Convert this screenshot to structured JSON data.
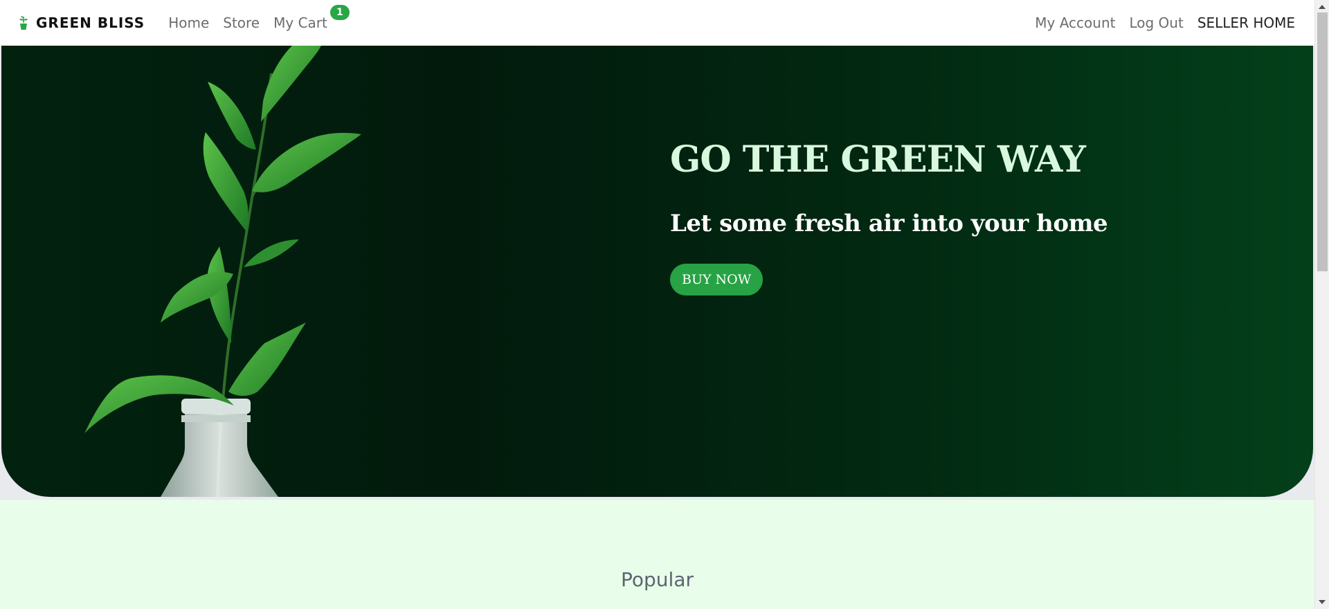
{
  "navbar": {
    "brand": "GREEN BLISS",
    "brand_icon": "plant-pot-icon",
    "links_left": [
      {
        "label": "Home"
      },
      {
        "label": "Store"
      },
      {
        "label": "My Cart",
        "badge": "1"
      }
    ],
    "links_right": [
      {
        "label": "My Account"
      },
      {
        "label": "Log Out"
      },
      {
        "label": "SELLER HOME"
      }
    ]
  },
  "hero": {
    "title": "GO THE GREEN WAY",
    "subtitle": "Let some fresh air into your home",
    "button": "BUY NOW",
    "image": "plant-in-glass-bottle"
  },
  "popular": {
    "title": "Popular"
  },
  "colors": {
    "accent": "#28a745",
    "hero_bg": "#021a0c",
    "hero_title": "#d8f9de",
    "section_bg": "#e8fdea"
  }
}
